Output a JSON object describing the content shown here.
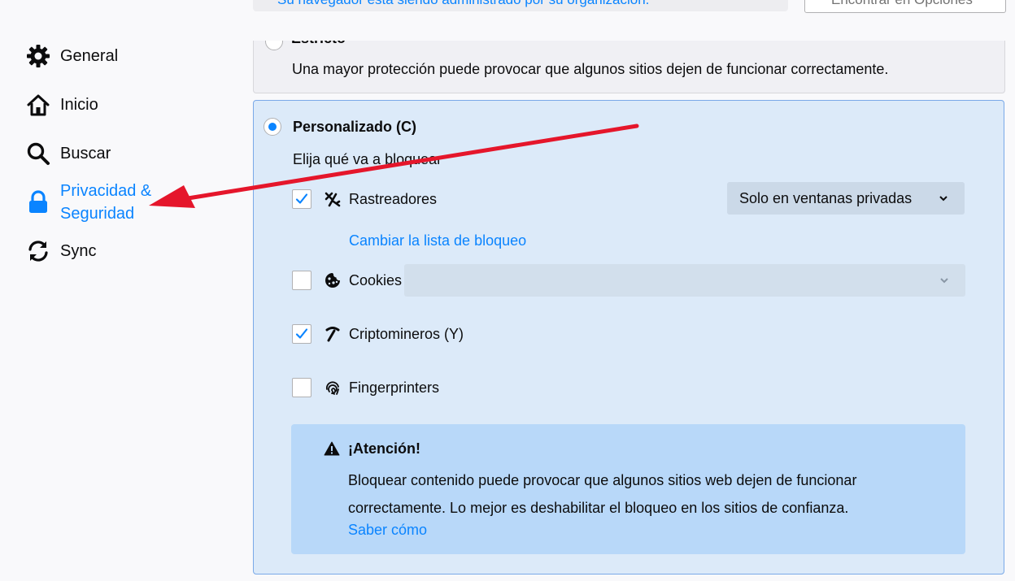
{
  "header": {
    "managed_notice": "Su navegador está siendo administrado por su organización.",
    "find_placeholder": "Encontrar en Opciones"
  },
  "sidebar": {
    "items": [
      {
        "label": "General",
        "icon": "gear-icon"
      },
      {
        "label": "Inicio",
        "icon": "home-icon"
      },
      {
        "label": "Buscar",
        "icon": "search-icon"
      },
      {
        "label": "Privacidad & Seguridad",
        "icon": "lock-icon",
        "selected": true
      },
      {
        "label": "Sync",
        "icon": "sync-icon"
      }
    ]
  },
  "strict": {
    "title": "Estricto",
    "description": "Una mayor protección puede provocar que algunos sitios dejen de funcionar correctamente."
  },
  "custom": {
    "title": "Personalizado (C)",
    "subtitle": "Elija qué va a bloquear",
    "trackers_label": "Rastreadores",
    "trackers_checked": true,
    "trackers_select": "Solo en ventanas privadas",
    "change_list_link": "Cambiar la lista de bloqueo",
    "cookies_label": "Cookies",
    "cookies_checked": false,
    "cookies_select": "",
    "cryptominers_label": "Criptomineros (Y)",
    "cryptominers_checked": true,
    "fingerprinters_label": "Fingerprinters",
    "fingerprinters_checked": false
  },
  "warning": {
    "title": "¡Atención!",
    "text": "Bloquear contenido puede provocar que algunos sitios web dejen de funcionar correctamente. Lo mejor es deshabilitar el bloqueo en los sitios de confianza.",
    "link": "Saber cómo"
  },
  "colors": {
    "accent": "#0a84ff",
    "annotation_arrow": "#e5162b",
    "selected_box_bg": "#dceaf9",
    "warning_bg": "#b8d8f9"
  }
}
